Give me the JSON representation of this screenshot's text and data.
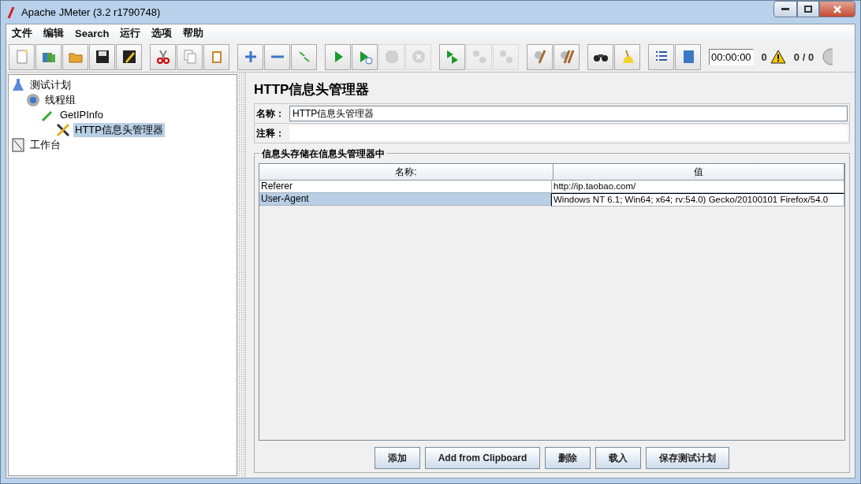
{
  "window": {
    "title": "Apache JMeter (3.2 r1790748)"
  },
  "menu": [
    "文件",
    "编辑",
    "Search",
    "运行",
    "选项",
    "帮助"
  ],
  "toolbar": {
    "groups": [
      [
        {
          "disabled": false
        },
        {
          "disabled": false
        },
        {
          "disabled": false
        },
        {
          "disabled": false
        },
        {
          "disabled": false
        }
      ],
      [
        {
          "disabled": false
        },
        {
          "disabled": false
        },
        {
          "disabled": false
        }
      ],
      [
        {
          "disabled": false
        },
        {
          "disabled": false
        },
        {
          "disabled": false
        }
      ],
      [
        {
          "disabled": false
        },
        {
          "disabled": false
        },
        {
          "disabled": true
        },
        {
          "disabled": true
        }
      ],
      [
        {
          "disabled": false
        },
        {
          "disabled": true
        },
        {
          "disabled": true
        }
      ],
      [
        {
          "disabled": false
        },
        {
          "disabled": false
        }
      ],
      [
        {
          "disabled": false
        },
        {
          "disabled": false
        }
      ],
      [
        {
          "disabled": false
        },
        {
          "disabled": false
        }
      ]
    ],
    "timer": "00:00:00",
    "warnings": "0",
    "threads": "0 / 0"
  },
  "tree": [
    {
      "label": "测试计划",
      "kind": "plan",
      "selected": false,
      "children": [
        {
          "label": "线程组",
          "kind": "threads",
          "selected": false,
          "children": [
            {
              "label": "GetIPInfo",
              "kind": "sampler",
              "selected": false,
              "children": [
                {
                  "label": "HTTP信息头管理器",
                  "kind": "config",
                  "selected": true
                }
              ]
            }
          ]
        }
      ]
    },
    {
      "label": "工作台",
      "kind": "workbench",
      "selected": false
    }
  ],
  "panel": {
    "title": "HTTP信息头管理器",
    "name_label": "名称：",
    "name_value": "HTTP信息头管理器",
    "comment_label": "注释：",
    "group_title": "信息头存储在信息头管理器中",
    "table": {
      "columns": [
        "名称:",
        "值"
      ],
      "rows": [
        {
          "cells": [
            "Referer",
            "http://ip.taobao.com/"
          ],
          "selected": false,
          "editing": false
        },
        {
          "cells": [
            "User-Agent",
            "Windows NT 6.1; Win64; x64; rv:54.0) Gecko/20100101 Firefox/54.0"
          ],
          "selected": true,
          "editing": true
        }
      ]
    },
    "buttons": [
      "添加",
      "Add from Clipboard",
      "删除",
      "载入",
      "保存测试计划"
    ]
  }
}
